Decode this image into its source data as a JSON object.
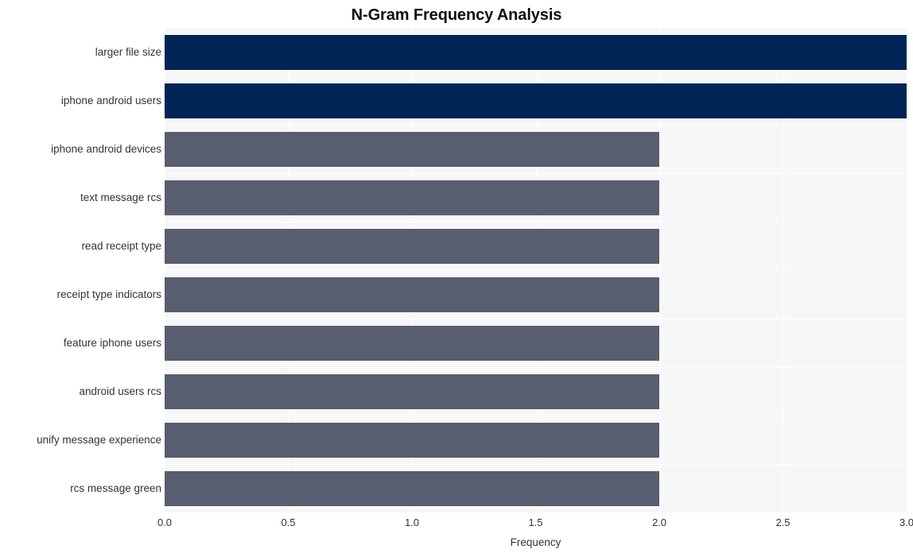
{
  "chart_data": {
    "type": "bar",
    "orientation": "horizontal",
    "title": "N-Gram Frequency Analysis",
    "xlabel": "Frequency",
    "ylabel": "",
    "categories": [
      "larger file size",
      "iphone android users",
      "iphone android devices",
      "text message rcs",
      "read receipt type",
      "receipt type indicators",
      "feature iphone users",
      "android users rcs",
      "unify message experience",
      "rcs message green"
    ],
    "values": [
      3,
      3,
      2,
      2,
      2,
      2,
      2,
      2,
      2,
      2
    ],
    "bar_colors": [
      "#002455",
      "#002455",
      "#585e70",
      "#585e70",
      "#585e70",
      "#585e70",
      "#585e70",
      "#585e70",
      "#585e70",
      "#585e70"
    ],
    "xlim": [
      0.0,
      3.0
    ],
    "xticks": [
      0.0,
      0.5,
      1.0,
      1.5,
      2.0,
      2.5,
      3.0
    ],
    "xtick_labels": [
      "0.0",
      "0.5",
      "1.0",
      "1.5",
      "2.0",
      "2.5",
      "3.0"
    ],
    "grid": true,
    "legend": null,
    "plot_background": "#f7f7f8",
    "figure_background": "#ffffff",
    "gridline_color": "#ffffff",
    "title_color": "#0e0e0e",
    "tick_label_color": "#333333"
  }
}
